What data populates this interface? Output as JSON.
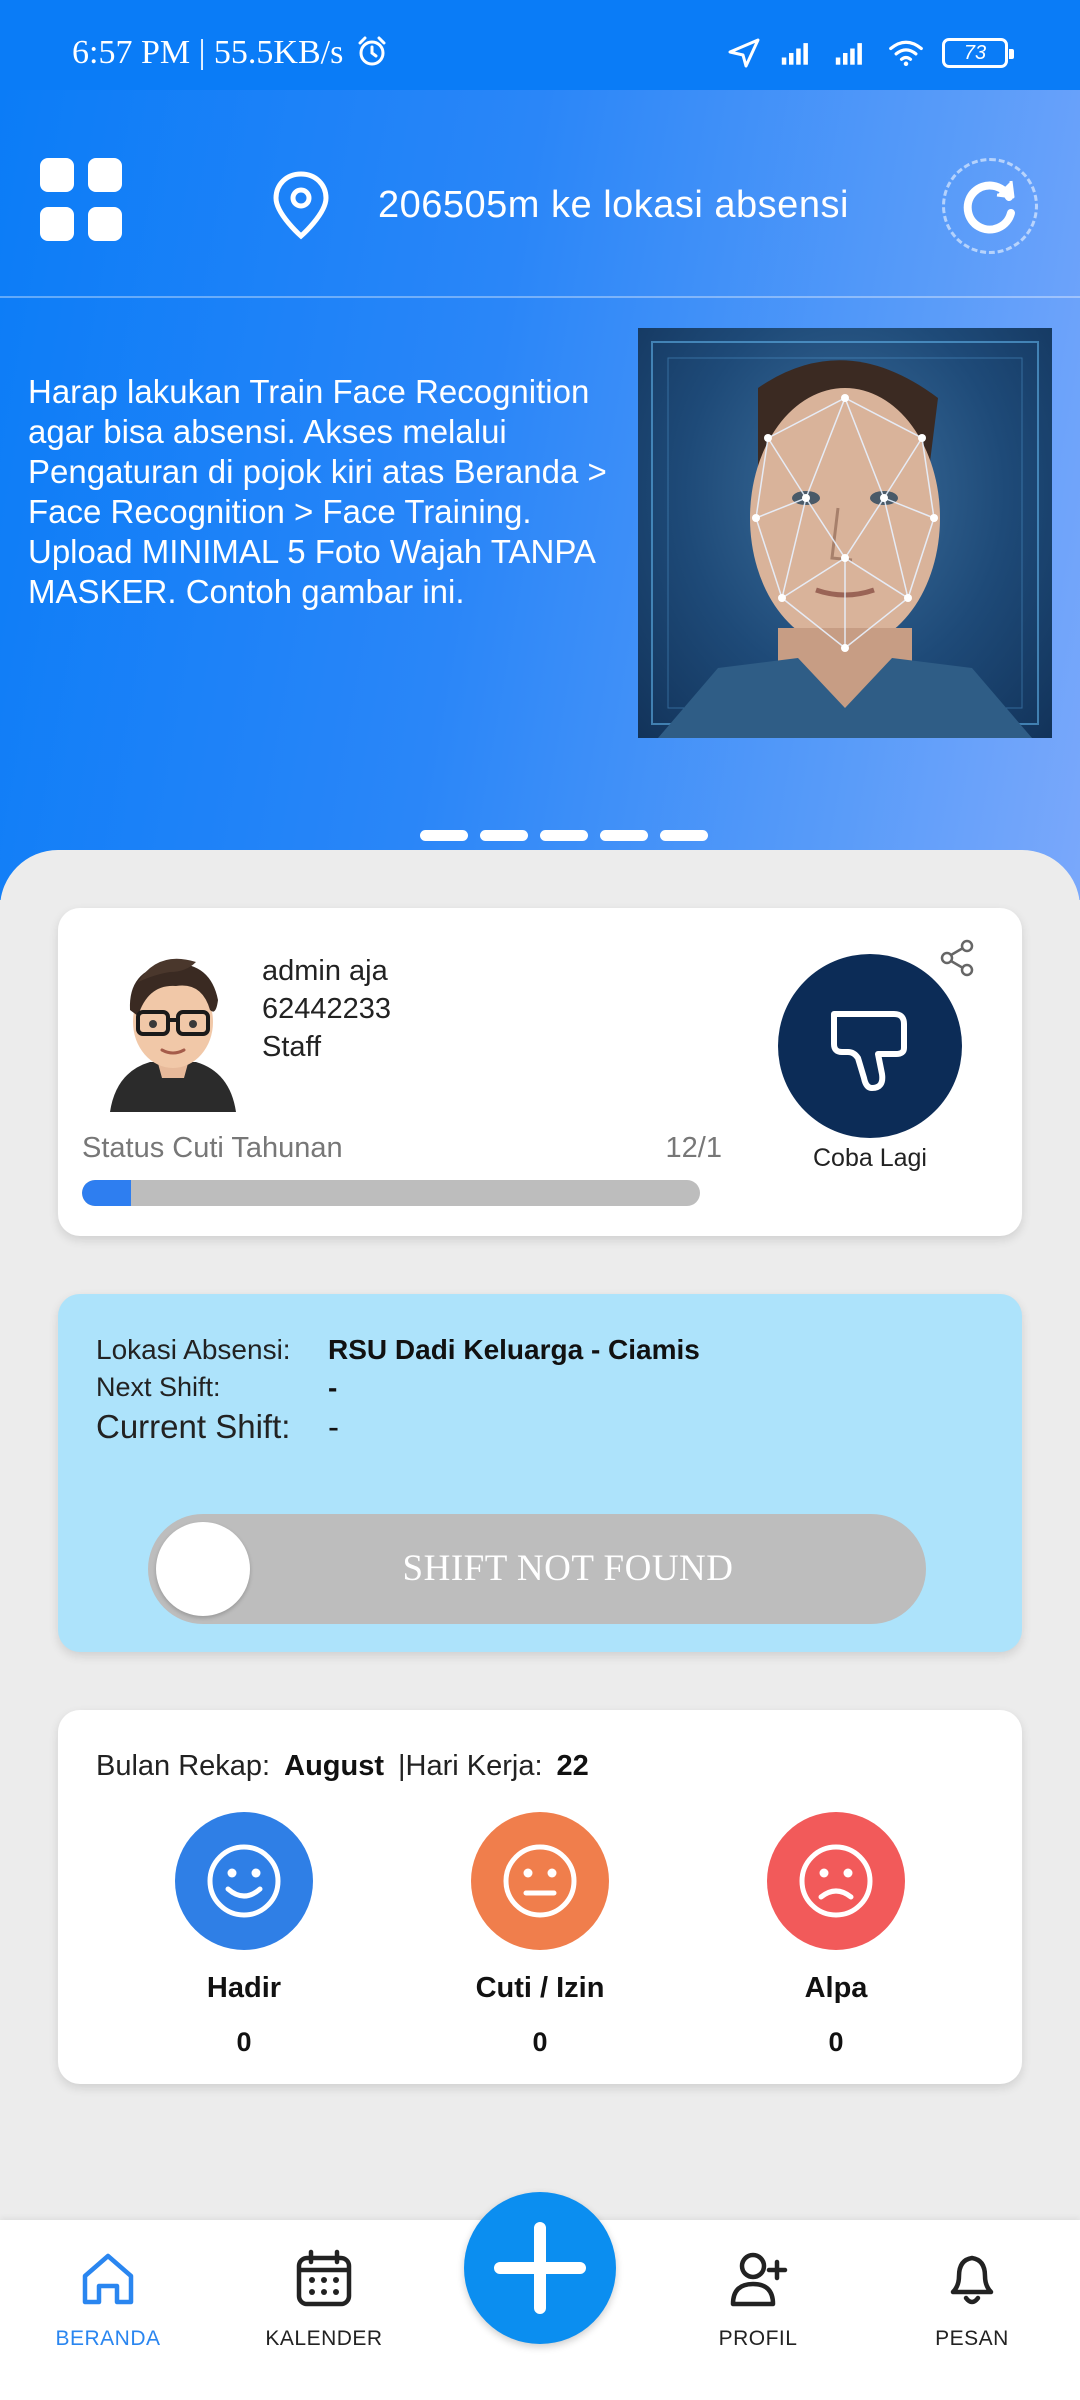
{
  "status_bar": {
    "time_speed": "6:57 PM | 55.5KB/s",
    "battery": "73",
    "icons": [
      "alarm-icon",
      "location-arrow-icon",
      "signal-icon",
      "signal-icon",
      "wifi-icon",
      "battery-icon"
    ]
  },
  "header": {
    "distance_text": "206505m ke lokasi absensi",
    "menu_icon": "grid-menu-icon",
    "location_icon": "location-pin-icon",
    "refresh_icon": "refresh-icon"
  },
  "banner": {
    "text": "Harap lakukan Train Face Recognition agar bisa absensi. Akses melalui Pengaturan di pojok kiri atas Beranda > Face Recognition > Face Training. Upload MINIMAL 5 Foto Wajah TANPA MASKER. Contoh gambar ini.",
    "slide_count": 5
  },
  "profile": {
    "name": "admin aja",
    "id": "62442233",
    "role": "Staff",
    "cuti_label": "Status Cuti Tahunan",
    "cuti_count": "12/1",
    "cuti_progress": 0.08,
    "action_label": "Coba Lagi"
  },
  "shift": {
    "lokasi_label": "Lokasi Absensi:",
    "lokasi_value": "RSU Dadi Keluarga - Ciamis",
    "next_label": "Next Shift:",
    "next_value": "-",
    "current_label": "Current Shift:",
    "current_value": "-",
    "slider_text": "SHIFT NOT FOUND"
  },
  "rekap": {
    "bulan_label": "Bulan Rekap:",
    "bulan_value": "August",
    "hari_label": "|Hari Kerja:",
    "hari_value": "22",
    "stats": [
      {
        "label": "Hadir",
        "value": "0",
        "color": "#2f7fe6"
      },
      {
        "label": "Cuti / Izin",
        "value": "0",
        "color": "#f07e4c"
      },
      {
        "label": "Alpa",
        "value": "0",
        "color": "#f25a5a"
      }
    ]
  },
  "nav": {
    "items": [
      {
        "label": "BERANDA",
        "icon": "home-icon",
        "active": true
      },
      {
        "label": "KALENDER",
        "icon": "calendar-icon",
        "active": false
      },
      {
        "label": "PROFIL",
        "icon": "add-user-icon",
        "active": false
      },
      {
        "label": "PESAN",
        "icon": "bell-icon",
        "active": false
      }
    ],
    "fab_icon": "plus-icon"
  },
  "colors": {
    "primary": "#0a7cf7",
    "accent_dark": "#0c2c57",
    "shift_card": "#ade3fb"
  }
}
